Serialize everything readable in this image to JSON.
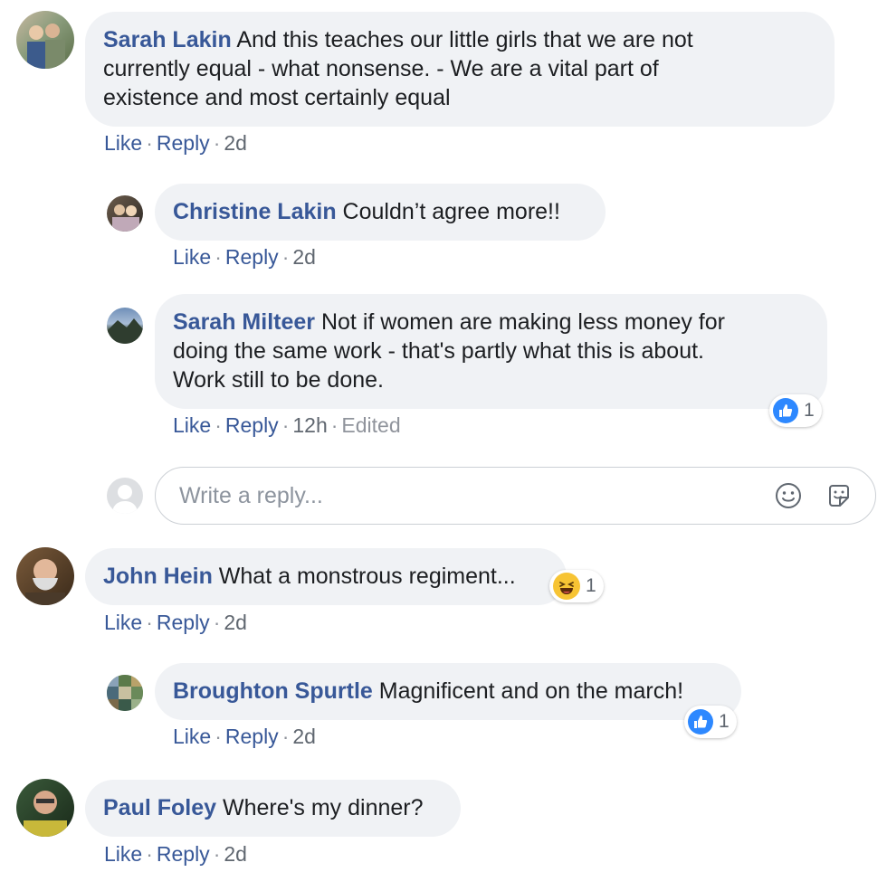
{
  "colors": {
    "link": "#385898",
    "bubble": "#f0f2f5",
    "like_blue": "#2d88ff",
    "haha_yellow": "#f7c434"
  },
  "actions": {
    "like": "Like",
    "reply": "Reply",
    "separator": "·"
  },
  "comments": [
    {
      "author": "Sarah Lakin",
      "text_lines": [
        "And this teaches our little girls that we are not",
        "currently equal - what nonsense. - We are a vital part of",
        "existence and most certainly equal"
      ],
      "time": "2d"
    },
    {
      "author": "Christine Lakin",
      "text": "Couldn’t agree more!!",
      "time": "2d"
    },
    {
      "author": "Sarah Milteer",
      "text_lines": [
        "Not if women are making less money for",
        "doing the same work - that's partly what this is about.",
        "Work still to be done."
      ],
      "time": "12h",
      "edited": "Edited",
      "reaction": {
        "icon": "like-icon",
        "count": "1"
      }
    },
    {
      "author": "John Hein",
      "text": "What a monstrous regiment...",
      "time": "2d",
      "reaction": {
        "icon": "haha-icon",
        "count": "1"
      }
    },
    {
      "author": "Broughton Spurtle",
      "text": "Magnificent and on the march!",
      "time": "2d",
      "reaction": {
        "icon": "like-icon",
        "count": "1"
      }
    },
    {
      "author": "Paul Foley",
      "text": "Where's my dinner?",
      "time": "2d"
    }
  ],
  "reply_box": {
    "placeholder": "Write a reply...",
    "emoji_icon": "smiley-icon",
    "sticker_icon": "sticker-icon"
  }
}
